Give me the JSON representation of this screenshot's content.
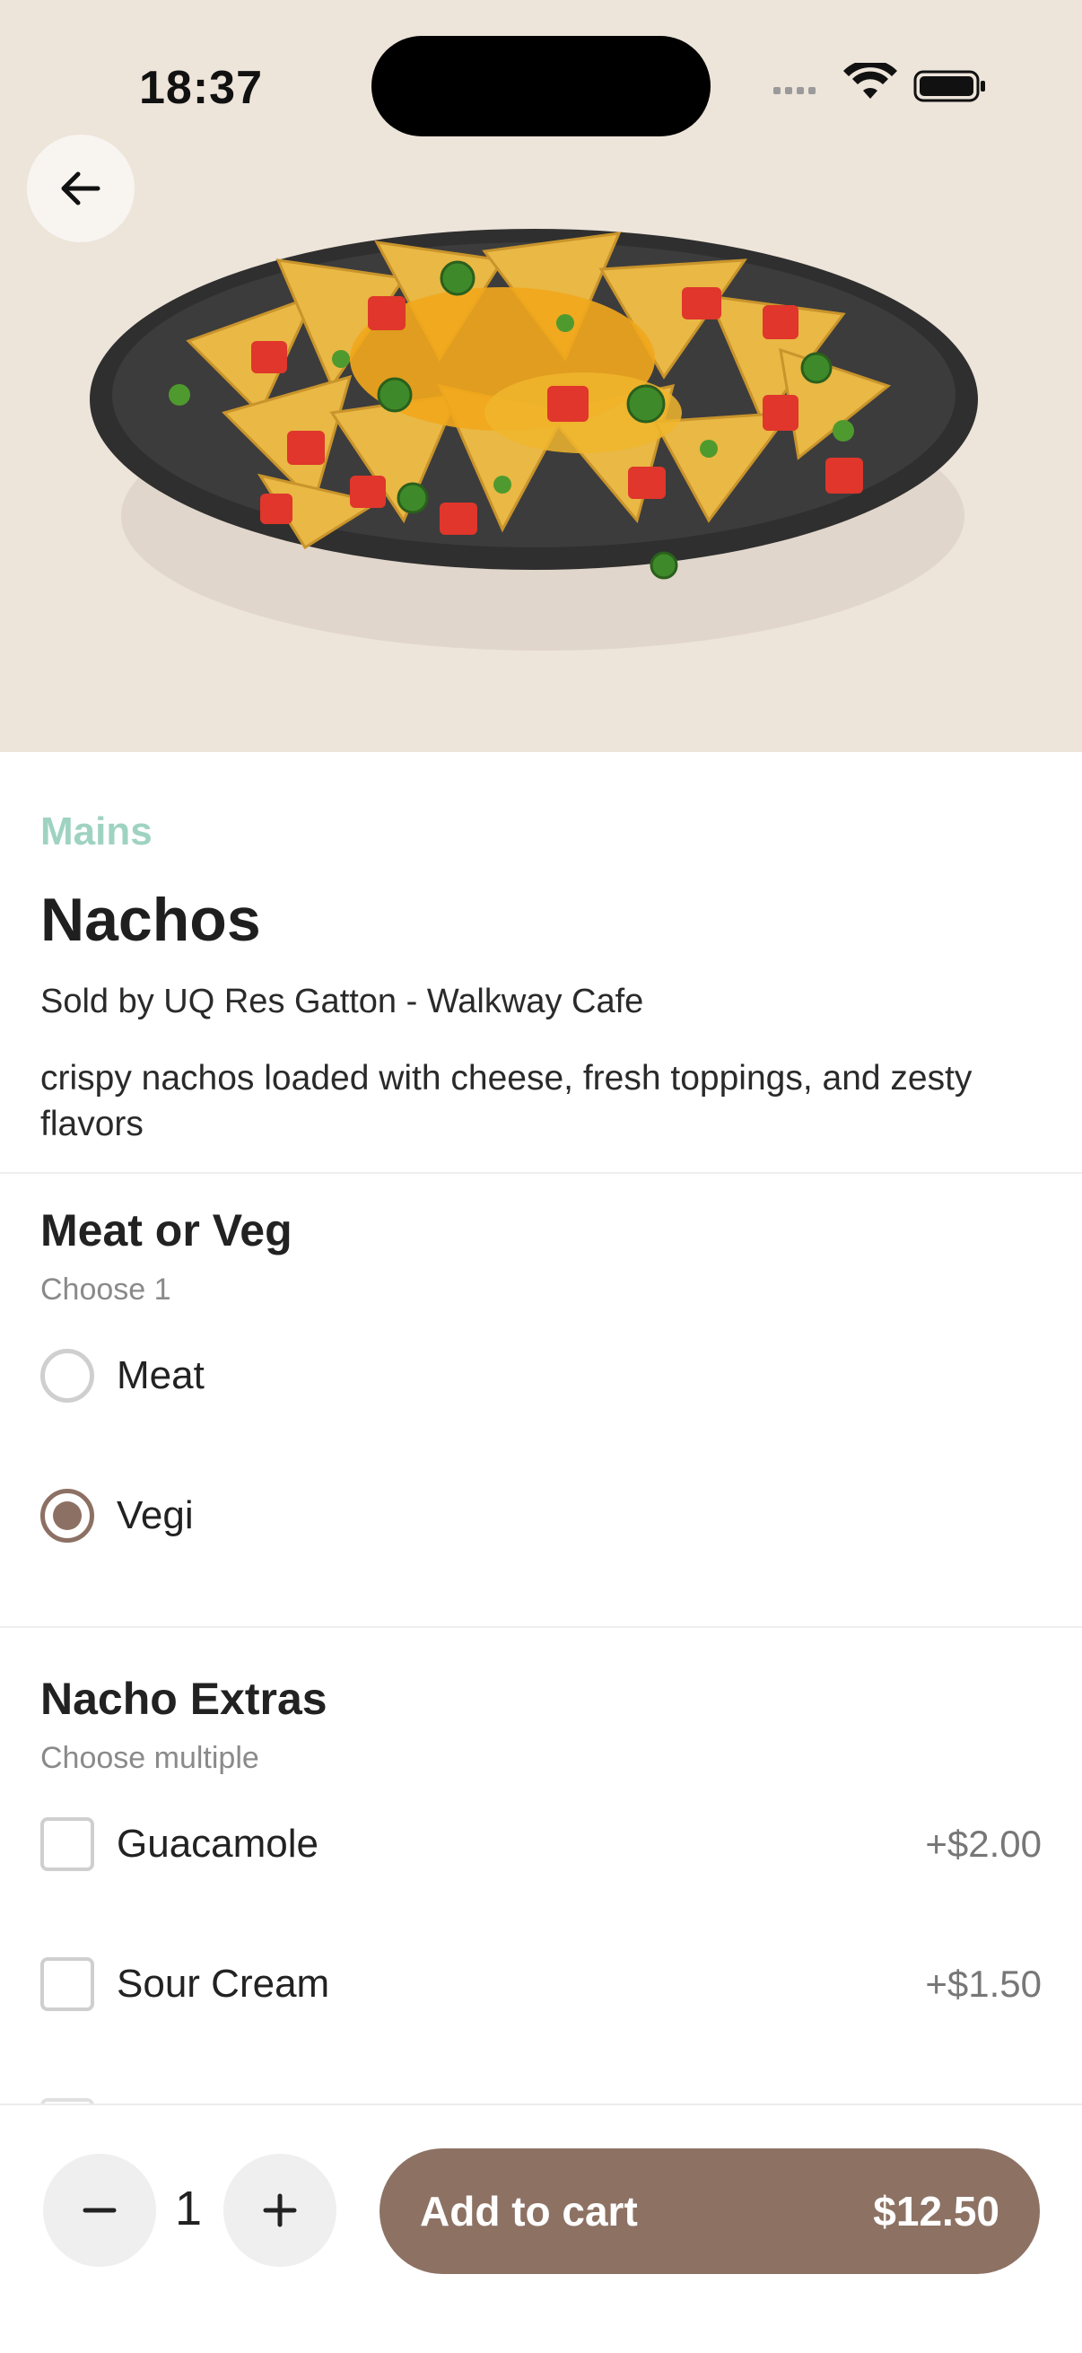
{
  "status_bar": {
    "time": "18:37"
  },
  "product": {
    "category": "Mains",
    "name": "Nachos",
    "seller": "Sold by UQ Res Gatton - Walkway Cafe",
    "description": "crispy nachos loaded with cheese, fresh toppings, and zesty flavors"
  },
  "meat_or_veg": {
    "title": "Meat or Veg",
    "subtitle": "Choose 1",
    "options": [
      {
        "label": "Meat",
        "selected": false
      },
      {
        "label": "Vegi",
        "selected": true
      }
    ]
  },
  "nacho_extras": {
    "title": "Nacho Extras",
    "subtitle": "Choose multiple",
    "options": [
      {
        "label": "Guacamole",
        "price": "+$2.00",
        "checked": false
      },
      {
        "label": "Sour Cream",
        "price": "+$1.50",
        "checked": false
      }
    ]
  },
  "cart": {
    "quantity": "1",
    "add_label": "Add to cart",
    "total": "$12.50",
    "accent_color": "#8d7264"
  },
  "icons": [
    "back-arrow-icon",
    "wifi-icon",
    "battery-icon",
    "signal-icon",
    "minus-icon",
    "plus-icon"
  ]
}
